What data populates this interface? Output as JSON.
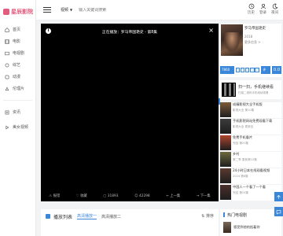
{
  "brand": {
    "name": "星辰影院"
  },
  "sidebar": {
    "items": [
      {
        "label": "首页",
        "icon": "home-icon"
      },
      {
        "label": "电影",
        "icon": "film-icon"
      },
      {
        "label": "电视剧",
        "icon": "tv-icon"
      },
      {
        "label": "综艺",
        "icon": "variety-icon"
      },
      {
        "label": "动漫",
        "icon": "anime-icon"
      },
      {
        "label": "伦理片",
        "icon": "ethics-icon"
      }
    ],
    "extra": [
      {
        "label": "资讯",
        "icon": "news-icon"
      },
      {
        "label": "美女视频",
        "icon": "video-icon"
      }
    ]
  },
  "header": {
    "search_type": "视频",
    "search_placeholder": "输入关键词搜索",
    "actions": [
      {
        "label": "历史",
        "icon": "history-icon"
      },
      {
        "label": "登录",
        "icon": "user-icon"
      },
      {
        "label": "夜间",
        "icon": "moon-icon"
      }
    ]
  },
  "player": {
    "title": "正在播放：罗马帝国艳史 - 第8集",
    "controls": [
      {
        "label": "报错",
        "glyph": "⚠"
      },
      {
        "label": "收藏",
        "glyph": "♡"
      },
      {
        "label": "31893",
        "glyph": "▢"
      },
      {
        "label": "42298",
        "glyph": "☺"
      },
      {
        "label": "上一集",
        "glyph": "←"
      },
      {
        "label": "下一集",
        "glyph": "→"
      }
    ]
  },
  "detail": {
    "title": "罗马帝国艳史",
    "year": "2018",
    "more": "更多信息 >",
    "badge": "7860人",
    "rate_label": "评分",
    "score": "0.0"
  },
  "qr": {
    "line1": "扫一扫，手机继续看",
    "line2": "扫描二维码手机继续观看"
  },
  "related": [
    {
      "title": "成精影视大全手机版",
      "sub": "影视大全 第10集",
      "color": "#7c5b3a"
    },
    {
      "title": "手机影院网站免费观看下载",
      "sub": "影视大全 更新至",
      "color": "#3c3c3c"
    },
    {
      "title": "免费手机看片",
      "sub": "完结 第20集",
      "color": "#b0452f"
    },
    {
      "title": "乡村",
      "sub": "第二季 更新第15集",
      "color": "#6d6a3e"
    },
    {
      "title": "24小时日本在线观看视频",
      "sub": "2024 第8集",
      "color": "#5a3a30"
    },
    {
      "title": "中国人一个看了一个看",
      "sub": "完结 第24集",
      "color": "#4a2f2a"
    }
  ],
  "playlist": {
    "title": "播放列表",
    "tabs": [
      "高清播放一",
      "高清播放二"
    ],
    "sort": "排序"
  },
  "hot": {
    "title": "热门电视剧",
    "item": "感受到他的抵着你"
  }
}
